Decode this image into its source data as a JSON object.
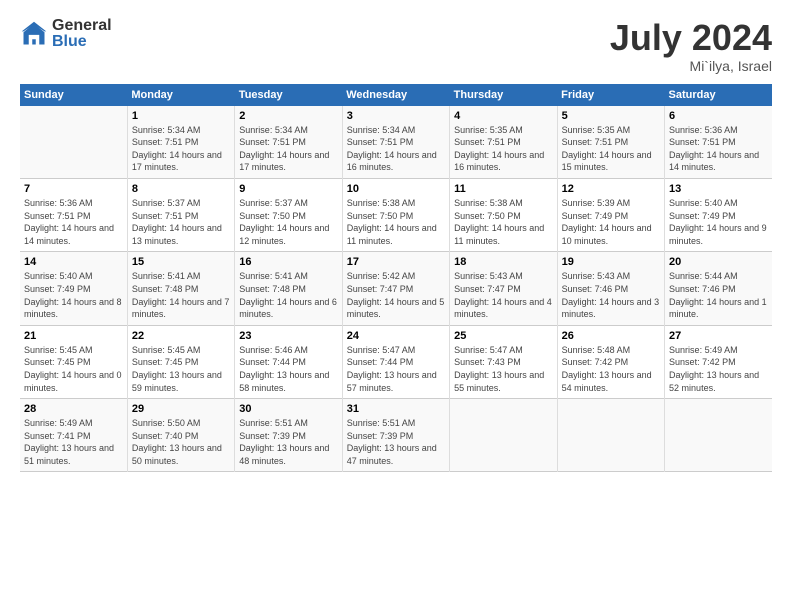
{
  "logo": {
    "general": "General",
    "blue": "Blue"
  },
  "title": "July 2024",
  "location": "Mi`ilya, Israel",
  "days_header": [
    "Sunday",
    "Monday",
    "Tuesday",
    "Wednesday",
    "Thursday",
    "Friday",
    "Saturday"
  ],
  "weeks": [
    [
      {
        "day": "",
        "sunrise": "",
        "sunset": "",
        "daylight": ""
      },
      {
        "day": "1",
        "sunrise": "Sunrise: 5:34 AM",
        "sunset": "Sunset: 7:51 PM",
        "daylight": "Daylight: 14 hours and 17 minutes."
      },
      {
        "day": "2",
        "sunrise": "Sunrise: 5:34 AM",
        "sunset": "Sunset: 7:51 PM",
        "daylight": "Daylight: 14 hours and 17 minutes."
      },
      {
        "day": "3",
        "sunrise": "Sunrise: 5:34 AM",
        "sunset": "Sunset: 7:51 PM",
        "daylight": "Daylight: 14 hours and 16 minutes."
      },
      {
        "day": "4",
        "sunrise": "Sunrise: 5:35 AM",
        "sunset": "Sunset: 7:51 PM",
        "daylight": "Daylight: 14 hours and 16 minutes."
      },
      {
        "day": "5",
        "sunrise": "Sunrise: 5:35 AM",
        "sunset": "Sunset: 7:51 PM",
        "daylight": "Daylight: 14 hours and 15 minutes."
      },
      {
        "day": "6",
        "sunrise": "Sunrise: 5:36 AM",
        "sunset": "Sunset: 7:51 PM",
        "daylight": "Daylight: 14 hours and 14 minutes."
      }
    ],
    [
      {
        "day": "7",
        "sunrise": "Sunrise: 5:36 AM",
        "sunset": "Sunset: 7:51 PM",
        "daylight": "Daylight: 14 hours and 14 minutes."
      },
      {
        "day": "8",
        "sunrise": "Sunrise: 5:37 AM",
        "sunset": "Sunset: 7:51 PM",
        "daylight": "Daylight: 14 hours and 13 minutes."
      },
      {
        "day": "9",
        "sunrise": "Sunrise: 5:37 AM",
        "sunset": "Sunset: 7:50 PM",
        "daylight": "Daylight: 14 hours and 12 minutes."
      },
      {
        "day": "10",
        "sunrise": "Sunrise: 5:38 AM",
        "sunset": "Sunset: 7:50 PM",
        "daylight": "Daylight: 14 hours and 11 minutes."
      },
      {
        "day": "11",
        "sunrise": "Sunrise: 5:38 AM",
        "sunset": "Sunset: 7:50 PM",
        "daylight": "Daylight: 14 hours and 11 minutes."
      },
      {
        "day": "12",
        "sunrise": "Sunrise: 5:39 AM",
        "sunset": "Sunset: 7:49 PM",
        "daylight": "Daylight: 14 hours and 10 minutes."
      },
      {
        "day": "13",
        "sunrise": "Sunrise: 5:40 AM",
        "sunset": "Sunset: 7:49 PM",
        "daylight": "Daylight: 14 hours and 9 minutes."
      }
    ],
    [
      {
        "day": "14",
        "sunrise": "Sunrise: 5:40 AM",
        "sunset": "Sunset: 7:49 PM",
        "daylight": "Daylight: 14 hours and 8 minutes."
      },
      {
        "day": "15",
        "sunrise": "Sunrise: 5:41 AM",
        "sunset": "Sunset: 7:48 PM",
        "daylight": "Daylight: 14 hours and 7 minutes."
      },
      {
        "day": "16",
        "sunrise": "Sunrise: 5:41 AM",
        "sunset": "Sunset: 7:48 PM",
        "daylight": "Daylight: 14 hours and 6 minutes."
      },
      {
        "day": "17",
        "sunrise": "Sunrise: 5:42 AM",
        "sunset": "Sunset: 7:47 PM",
        "daylight": "Daylight: 14 hours and 5 minutes."
      },
      {
        "day": "18",
        "sunrise": "Sunrise: 5:43 AM",
        "sunset": "Sunset: 7:47 PM",
        "daylight": "Daylight: 14 hours and 4 minutes."
      },
      {
        "day": "19",
        "sunrise": "Sunrise: 5:43 AM",
        "sunset": "Sunset: 7:46 PM",
        "daylight": "Daylight: 14 hours and 3 minutes."
      },
      {
        "day": "20",
        "sunrise": "Sunrise: 5:44 AM",
        "sunset": "Sunset: 7:46 PM",
        "daylight": "Daylight: 14 hours and 1 minute."
      }
    ],
    [
      {
        "day": "21",
        "sunrise": "Sunrise: 5:45 AM",
        "sunset": "Sunset: 7:45 PM",
        "daylight": "Daylight: 14 hours and 0 minutes."
      },
      {
        "day": "22",
        "sunrise": "Sunrise: 5:45 AM",
        "sunset": "Sunset: 7:45 PM",
        "daylight": "Daylight: 13 hours and 59 minutes."
      },
      {
        "day": "23",
        "sunrise": "Sunrise: 5:46 AM",
        "sunset": "Sunset: 7:44 PM",
        "daylight": "Daylight: 13 hours and 58 minutes."
      },
      {
        "day": "24",
        "sunrise": "Sunrise: 5:47 AM",
        "sunset": "Sunset: 7:44 PM",
        "daylight": "Daylight: 13 hours and 57 minutes."
      },
      {
        "day": "25",
        "sunrise": "Sunrise: 5:47 AM",
        "sunset": "Sunset: 7:43 PM",
        "daylight": "Daylight: 13 hours and 55 minutes."
      },
      {
        "day": "26",
        "sunrise": "Sunrise: 5:48 AM",
        "sunset": "Sunset: 7:42 PM",
        "daylight": "Daylight: 13 hours and 54 minutes."
      },
      {
        "day": "27",
        "sunrise": "Sunrise: 5:49 AM",
        "sunset": "Sunset: 7:42 PM",
        "daylight": "Daylight: 13 hours and 52 minutes."
      }
    ],
    [
      {
        "day": "28",
        "sunrise": "Sunrise: 5:49 AM",
        "sunset": "Sunset: 7:41 PM",
        "daylight": "Daylight: 13 hours and 51 minutes."
      },
      {
        "day": "29",
        "sunrise": "Sunrise: 5:50 AM",
        "sunset": "Sunset: 7:40 PM",
        "daylight": "Daylight: 13 hours and 50 minutes."
      },
      {
        "day": "30",
        "sunrise": "Sunrise: 5:51 AM",
        "sunset": "Sunset: 7:39 PM",
        "daylight": "Daylight: 13 hours and 48 minutes."
      },
      {
        "day": "31",
        "sunrise": "Sunrise: 5:51 AM",
        "sunset": "Sunset: 7:39 PM",
        "daylight": "Daylight: 13 hours and 47 minutes."
      },
      {
        "day": "",
        "sunrise": "",
        "sunset": "",
        "daylight": ""
      },
      {
        "day": "",
        "sunrise": "",
        "sunset": "",
        "daylight": ""
      },
      {
        "day": "",
        "sunrise": "",
        "sunset": "",
        "daylight": ""
      }
    ]
  ]
}
